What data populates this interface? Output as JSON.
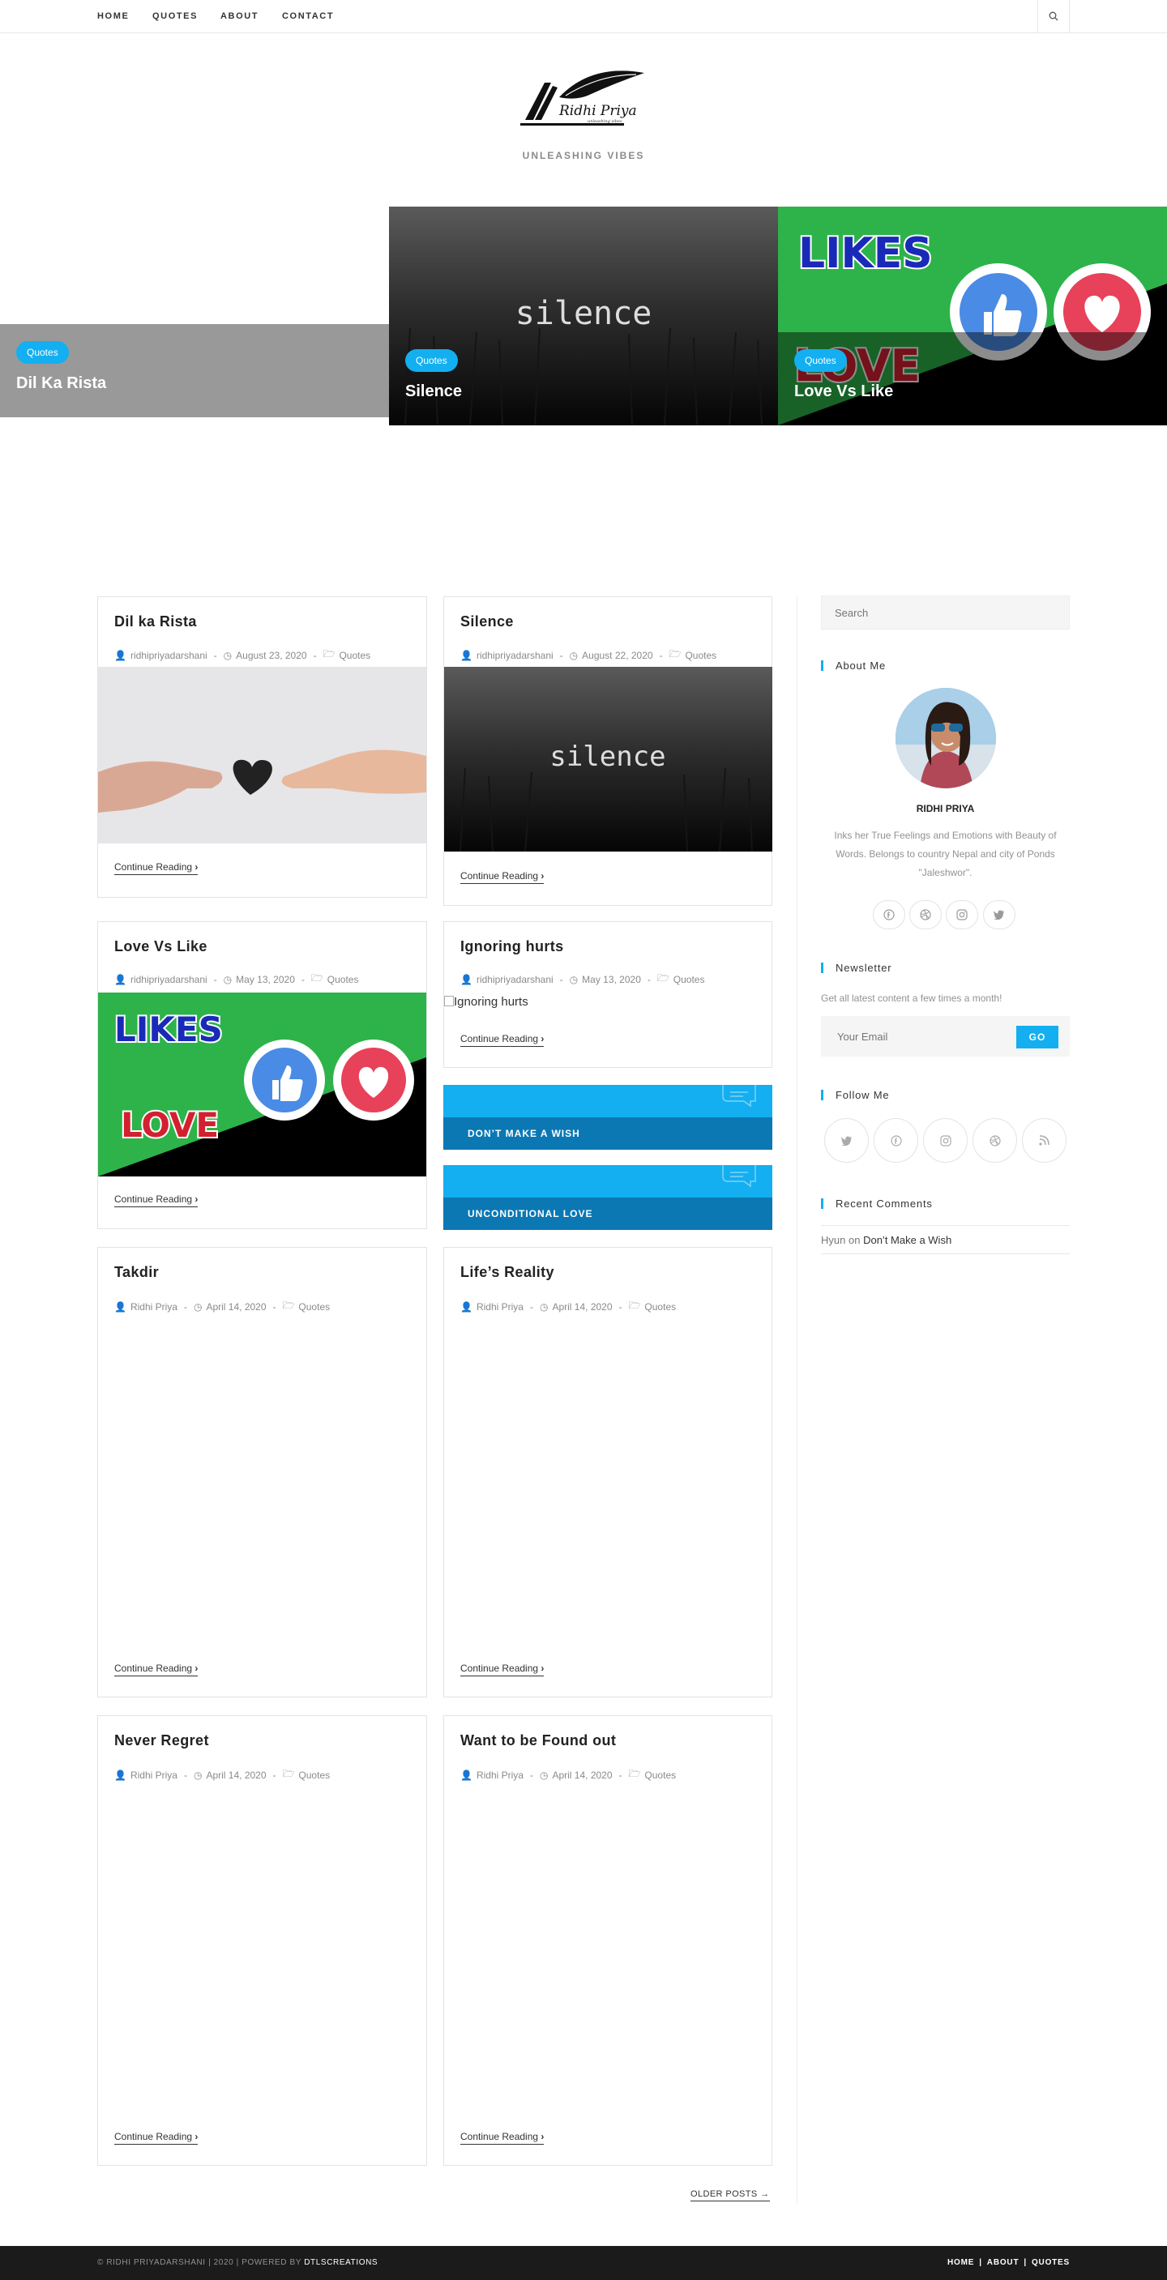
{
  "nav": {
    "items": [
      "HOME",
      "QUOTES",
      "ABOUT",
      "CONTACT"
    ]
  },
  "logo": {
    "text": "Ridhi Priya",
    "subtext": "unleashing vibes"
  },
  "tagline": "UNLEASHING VIBES",
  "slider": [
    {
      "category": "Quotes",
      "title": "Dil Ka Rista"
    },
    {
      "category": "Quotes",
      "title": "Silence",
      "image_text": "silence"
    },
    {
      "category": "Quotes",
      "title": "Love Vs Like",
      "image_text_1": "LIKES",
      "image_text_2": "LOVE"
    }
  ],
  "posts": [
    {
      "title": "Dil ka Rista",
      "author": "ridhipriyadarshani",
      "date": "August 23, 2020",
      "category": "Quotes",
      "more": "Continue Reading"
    },
    {
      "title": "Silence",
      "author": "ridhipriyadarshani",
      "date": "August 22, 2020",
      "category": "Quotes",
      "more": "Continue Reading",
      "image_text": "silence"
    },
    {
      "title": "Love Vs Like",
      "author": "ridhipriyadarshani",
      "date": "May 13, 2020",
      "category": "Quotes",
      "more": "Continue Reading",
      "image_text_1": "LIKES",
      "image_text_2": "LOVE"
    },
    {
      "title": "Ignoring hurts",
      "author": "ridhipriyadarshani",
      "date": "May 13, 2020",
      "category": "Quotes",
      "more": "Continue Reading",
      "image_alt": "Ignoring hurts"
    },
    {
      "title": "Takdir",
      "author": "Ridhi Priya",
      "date": "April 14, 2020",
      "category": "Quotes",
      "more": "Continue Reading"
    },
    {
      "title": "Life’s Reality",
      "author": "Ridhi Priya",
      "date": "April 14, 2020",
      "category": "Quotes",
      "more": "Continue Reading"
    },
    {
      "title": "Never Regret",
      "author": "Ridhi Priya",
      "date": "April 14, 2020",
      "category": "Quotes",
      "more": "Continue Reading"
    },
    {
      "title": "Want to be Found out",
      "author": "Ridhi Priya",
      "date": "April 14, 2020",
      "category": "Quotes",
      "more": "Continue Reading"
    }
  ],
  "quote_cards": [
    {
      "label": "DON’T MAKE A WISH"
    },
    {
      "label": "UNCONDITIONAL LOVE"
    }
  ],
  "pagination": {
    "older": "OLDER POSTS →"
  },
  "sidebar": {
    "search_placeholder": "Search",
    "about_title": "About Me",
    "about_name": "RIDHI PRIYA",
    "about_text": "Inks her True Feelings and Emotions with Beauty of Words. Belongs to country Nepal and city of Ponds \"Jaleshwor\".",
    "newsletter_title": "Newsletter",
    "newsletter_text": "Get all latest content a few times a month!",
    "email_placeholder": "Your Email",
    "go_label": "GO",
    "follow_title": "Follow Me",
    "recent_title": "Recent Comments",
    "recent_author": "Hyun",
    "recent_on": "on",
    "recent_post": "Don’t Make a Wish"
  },
  "footer": {
    "left_prefix": "© RIDHI PRIYADARSHANI | 2020 | POWERED BY ",
    "left_link": "DTLSCREATIONS",
    "right": [
      "HOME",
      "|",
      "ABOUT",
      "|",
      "QUOTES"
    ]
  },
  "colors": {
    "accent": "#13aff0",
    "dark_blue": "#0b78b4",
    "footer_bg": "#1b1b1b",
    "green": "#2db34a",
    "red": "#e8415a"
  },
  "icons": [
    "search-icon",
    "user-icon",
    "clock-icon",
    "folder-icon",
    "facebook-icon",
    "dribbble-icon",
    "instagram-icon",
    "twitter-icon",
    "rss-icon",
    "chat-bubble-icon",
    "thumbs-up-icon",
    "heart-icon"
  ]
}
